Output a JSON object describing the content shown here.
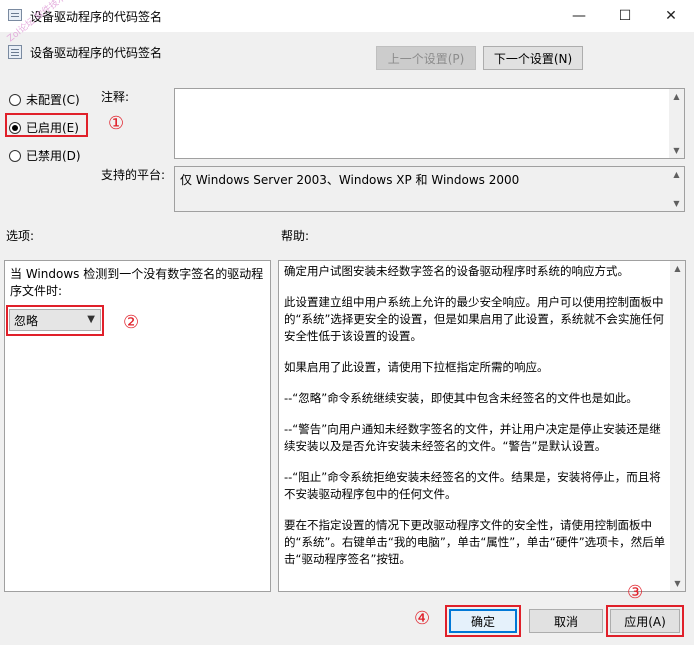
{
  "window": {
    "title": "设备驱动程序的代码签名",
    "controls": {
      "minimize": "—",
      "maximize": "☐",
      "close": "✕"
    },
    "watermark": "Zol论坛 软件技术"
  },
  "header": {
    "policy_title": "设备驱动程序的代码签名",
    "prev_button": "上一个设置(P)",
    "next_button": "下一个设置(N)"
  },
  "state_options": [
    {
      "label": "未配置(C)",
      "checked": false
    },
    {
      "label": "已启用(E)",
      "checked": true
    },
    {
      "label": "已禁用(D)",
      "checked": false
    }
  ],
  "annotations": {
    "one": "①",
    "two": "②",
    "three": "③",
    "four": "④"
  },
  "comment": {
    "label": "注释:",
    "value": ""
  },
  "platform": {
    "label": "支持的平台:",
    "value": "仅 Windows Server 2003、Windows XP 和 Windows 2000"
  },
  "options": {
    "label": "选项:",
    "description": "当 Windows 检测到一个没有数字签名的驱动程序文件时:",
    "selected": "忽略"
  },
  "help": {
    "label": "帮助:",
    "paragraphs": [
      "确定用户试图安装未经数字签名的设备驱动程序时系统的响应方式。",
      "此设置建立组中用户系统上允许的最少安全响应。用户可以使用控制面板中的“系统”选择更安全的设置，但是如果启用了此设置，系统就不会实施任何安全性低于该设置的设置。",
      "如果启用了此设置，请使用下拉框指定所需的响应。",
      "--“忽略”命令系统继续安装，即使其中包含未经签名的文件也是如此。",
      "--“警告”向用户通知未经数字签名的文件，并让用户决定是停止安装还是继续安装以及是否允许安装未经签名的文件。“警告”是默认设置。",
      "--“阻止”命令系统拒绝安装未经签名的文件。结果是，安装将停止，而且将不安装驱动程序包中的任何文件。",
      "要在不指定设置的情况下更改驱动程序文件的安全性，请使用控制面板中的“系统”。右键单击“我的电脑”，单击“属性”，单击“硬件”选项卡，然后单击“驱动程序签名”按钮。"
    ]
  },
  "footer": {
    "ok": "确定",
    "cancel": "取消",
    "apply": "应用(A)"
  }
}
